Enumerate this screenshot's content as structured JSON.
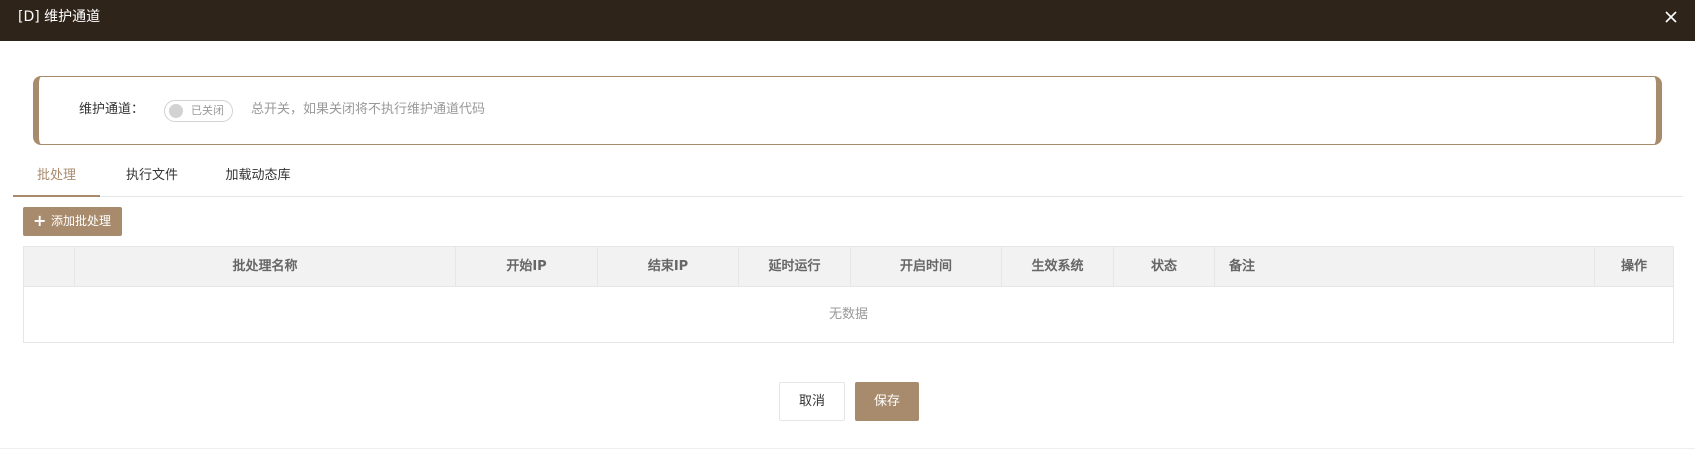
{
  "window": {
    "title": "[D] 维护通道",
    "close_icon": "close-icon"
  },
  "switch_panel": {
    "label": "维护通道：",
    "toggle_state_text": "已关闭",
    "toggle_on": false,
    "hint": "总开关，如果关闭将不执行维护通道代码"
  },
  "tabs": [
    {
      "label": "批处理",
      "active": true
    },
    {
      "label": "执行文件",
      "active": false
    },
    {
      "label": "加载动态库",
      "active": false
    }
  ],
  "add_button": {
    "icon": "plus-icon",
    "label": "添加批处理"
  },
  "table": {
    "columns": [
      "",
      "批处理名称",
      "开始IP",
      "结束IP",
      "延时运行",
      "开启时间",
      "生效系统",
      "状态",
      "备注",
      "操作"
    ],
    "rows": [],
    "empty_text": "无数据"
  },
  "footer": {
    "cancel_label": "取消",
    "save_label": "保存"
  },
  "colors": {
    "titlebar": "#2f241a",
    "accent": "#a88b6d"
  }
}
